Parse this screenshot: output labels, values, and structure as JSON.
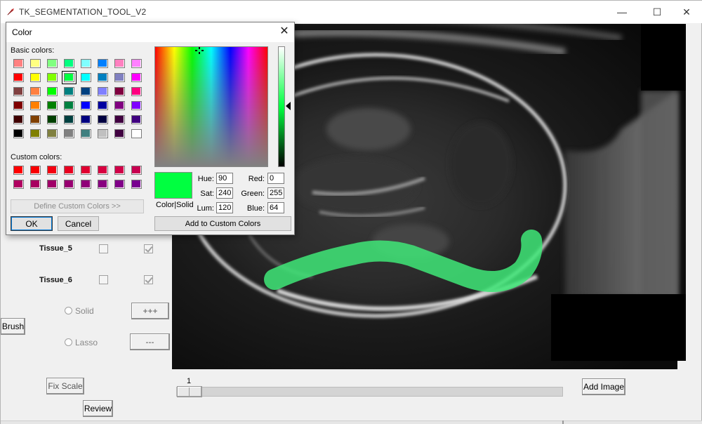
{
  "window": {
    "title": "TK_SEGMENTATION_TOOL_V2",
    "minimize_glyph": "—",
    "maximize_glyph": "☐",
    "close_glyph": "✕"
  },
  "left_panel": {
    "tissues": [
      {
        "label": "Tissue_5",
        "check_a": false,
        "check_b": true
      },
      {
        "label": "Tissue_6",
        "check_a": false,
        "check_b": true
      }
    ],
    "brush_label": "Brush",
    "solid_label": "Solid",
    "lasso_label": "Lasso",
    "plus_label": "+++",
    "minus_label": "---",
    "fix_scale_label": "Fix Scale",
    "review_label": "Review"
  },
  "slider": {
    "value": "1"
  },
  "add_image_label": "Add Image",
  "color_dialog": {
    "title": "Color",
    "basic_colors_label": "Basic colors:",
    "custom_colors_label": "Custom colors:",
    "basic_colors": [
      "#ff8080",
      "#ffff80",
      "#80ff80",
      "#00ff80",
      "#80ffff",
      "#0080ff",
      "#ff80c0",
      "#ff80ff",
      "#ff0000",
      "#ffff00",
      "#80ff00",
      "#00ff40",
      "#00ffff",
      "#0080c0",
      "#8080c0",
      "#ff00ff",
      "#804040",
      "#ff8040",
      "#00ff00",
      "#008080",
      "#004080",
      "#8080ff",
      "#800040",
      "#ff0080",
      "#800000",
      "#ff8000",
      "#008000",
      "#008040",
      "#0000ff",
      "#0000a0",
      "#800080",
      "#8000ff",
      "#400000",
      "#804000",
      "#004000",
      "#004040",
      "#000080",
      "#000040",
      "#400040",
      "#400080",
      "#000000",
      "#808000",
      "#808040",
      "#808080",
      "#408080",
      "#c0c0c0",
      "#400040",
      "#ffffff"
    ],
    "selected_basic_index": 11,
    "custom_colors": [
      "#ff0000",
      "#f80000",
      "#f40010",
      "#e80020",
      "#e00030",
      "#d80040",
      "#d00048",
      "#c80050",
      "#b00060",
      "#a80060",
      "#a00068",
      "#980070",
      "#900078",
      "#880080",
      "#800088",
      "#780090"
    ],
    "define_custom_label": "Define Custom Colors >>",
    "ok_label": "OK",
    "cancel_label": "Cancel",
    "add_custom_label": "Add to Custom Colors",
    "preview_label": "Color|Solid",
    "preview_color": "#00ff40",
    "hue_label": "Hue:",
    "hue": "90",
    "sat_label": "Sat:",
    "sat": "240",
    "lum_label": "Lum:",
    "lum": "120",
    "red_label": "Red:",
    "red": "0",
    "green_label": "Green:",
    "green": "255",
    "blue_label": "Blue:",
    "blue": "64"
  },
  "segmentation_color": "#3fe878"
}
